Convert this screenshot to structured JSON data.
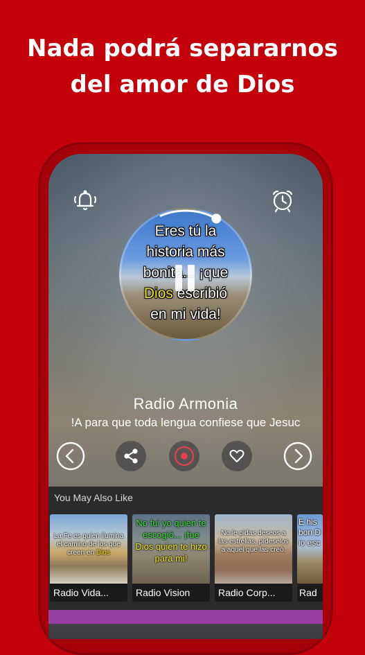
{
  "headline": {
    "line1": "Nada podrá separarnos",
    "line2": "del amor de Dios"
  },
  "player": {
    "artwork_text_a": "Eres tú la",
    "artwork_text_b": "historia más",
    "artwork_text_c": "bonita... ¡que",
    "artwork_text_d": "Dios",
    "artwork_text_e": " escribió",
    "artwork_text_f": "en mi vida!",
    "station_name": "Radio Armonia",
    "now_playing": "!A para que toda lengua confiese que Jesuc",
    "progress_fraction": 0.08,
    "icons": {
      "left_top": "bell-icon",
      "right_top": "alarm-clock-icon",
      "center": "pause-icon",
      "controls": [
        "chevron-left-icon",
        "share-icon",
        "record-icon",
        "heart-icon",
        "chevron-right-icon"
      ]
    },
    "accent_color": "#e2404a"
  },
  "recommendations": {
    "title": "You May Also Like",
    "items": [
      {
        "label": "Radio Vida...",
        "thumb_text_a": "La Fe es quien ilumina el camino de los que creen en",
        "thumb_text_b": "Dios"
      },
      {
        "label": "Radio Vision",
        "thumb_text_a": "No fui yo quien te escogió... ¡fue",
        "thumb_text_b": "Dios quien te hizo para mi!"
      },
      {
        "label": "Radio Corp...",
        "thumb_text_a": "No le pidas deseos a las estrellas, pídeselos a aquel que las creó.",
        "thumb_text_b": ""
      },
      {
        "label": "Rad",
        "thumb_text_a": "E his bon Dio esc",
        "thumb_text_b": ""
      }
    ]
  },
  "colors": {
    "background": "#c4000b",
    "bottom_bar": "#9a3fa2"
  }
}
